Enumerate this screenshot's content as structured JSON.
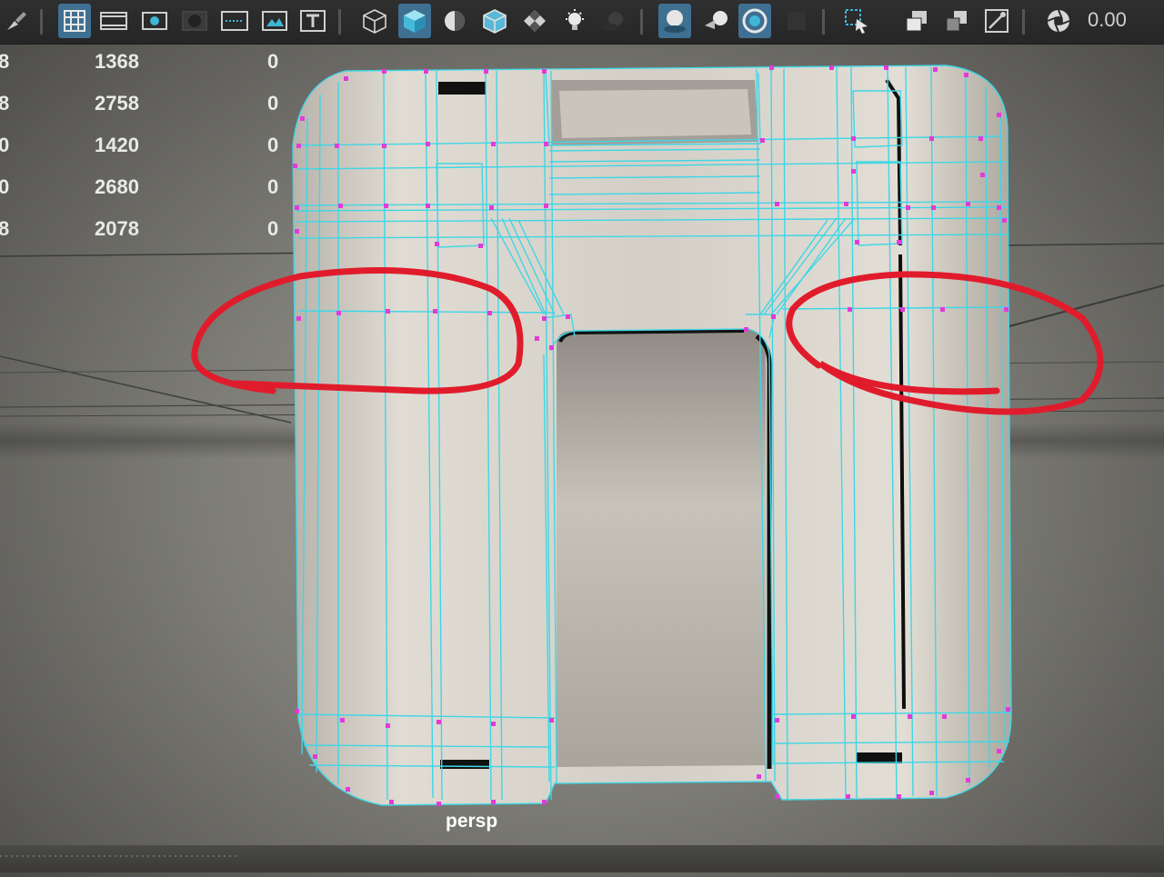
{
  "toolbar": {
    "icons": [
      "paint-brush-icon",
      "grid-icon",
      "film-gate-icon",
      "resolution-gate-icon",
      "gate-mask-icon",
      "field-chart-icon",
      "safe-action-icon",
      "safe-title-icon",
      "wireframe-cube-icon",
      "smooth-shade-cube-icon",
      "xray-icon",
      "wireframe-on-shaded-icon",
      "checker-texture-icon",
      "light-bulb-icon",
      "shadows-icon",
      "ambient-occlusion-icon",
      "motion-blur-icon",
      "screen-space-icon",
      "isolate-icon",
      "select-camera-icon",
      "camera-attributes-icon",
      "bookmarks-icon",
      "image-plane-icon",
      "exposure-icon"
    ],
    "frame_value": "0.00"
  },
  "hud": {
    "rows": [
      {
        "lead": "8",
        "value": "1368",
        "zero": "0"
      },
      {
        "lead": "8",
        "value": "2758",
        "zero": "0"
      },
      {
        "lead": "0",
        "value": "1420",
        "zero": "0"
      },
      {
        "lead": "0",
        "value": "2680",
        "zero": "0"
      },
      {
        "lead": "8",
        "value": "2078",
        "zero": "0"
      }
    ]
  },
  "viewport": {
    "camera_label": "persp",
    "wire_color": "#3fd6e6",
    "vertex_color": "#e23ad8",
    "annotation_color": "#e01c2c",
    "active_button_color": "#3f6f91"
  }
}
